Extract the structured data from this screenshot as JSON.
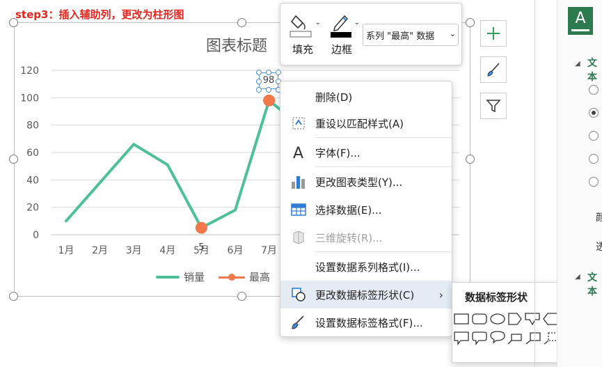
{
  "step_label": "step3：插入辅助列，更改为柱形图",
  "chart_data": {
    "type": "line",
    "title": "图表标题",
    "categories": [
      "1月",
      "2月",
      "3月",
      "4月",
      "5月",
      "6月",
      "7月"
    ],
    "ylim": [
      0,
      120
    ],
    "yticks": [
      "0",
      "20",
      "40",
      "60",
      "80",
      "100",
      "120"
    ],
    "series": [
      {
        "name": "销量",
        "color": "#4dbf9b",
        "values": [
          10,
          38,
          66,
          51,
          5,
          18,
          98,
          78
        ]
      },
      {
        "name": "最高",
        "color": "#f2774a",
        "markers": [
          {
            "index": 4,
            "value": 5
          },
          {
            "index": 6,
            "value": 98
          }
        ]
      }
    ],
    "data_labels": [
      {
        "text": "98"
      },
      {
        "text": "5"
      }
    ],
    "legend_position": "bottom",
    "grid": true
  },
  "mini_toolbar": {
    "fill_label": "填充",
    "outline_label": "边框",
    "series_select_value": "系列 \"最高\" 数据"
  },
  "context_menu": {
    "items": [
      {
        "label": "删除(D)"
      },
      {
        "label": "重设以匹配样式(A)"
      },
      {
        "label": "字体(F)..."
      },
      {
        "label": "更改图表类型(Y)..."
      },
      {
        "label": "选择数据(E)..."
      },
      {
        "label": "三维旋转(R)..."
      },
      {
        "label": "设置数据系列格式(I)..."
      },
      {
        "label": "更改数据标签形状(C)"
      },
      {
        "label": "设置数据标签格式(F)..."
      }
    ]
  },
  "submenu": {
    "title": "数据标签形状"
  },
  "right_panel": {
    "tab_letter": "A",
    "section1": "文本",
    "section2": "文本",
    "label1": "颜",
    "label2": "透"
  },
  "colors": {
    "accent_red": "#e8241c",
    "series_green": "#4dbf9b",
    "series_orange": "#f2774a",
    "panel_green": "#2d7a4f"
  }
}
